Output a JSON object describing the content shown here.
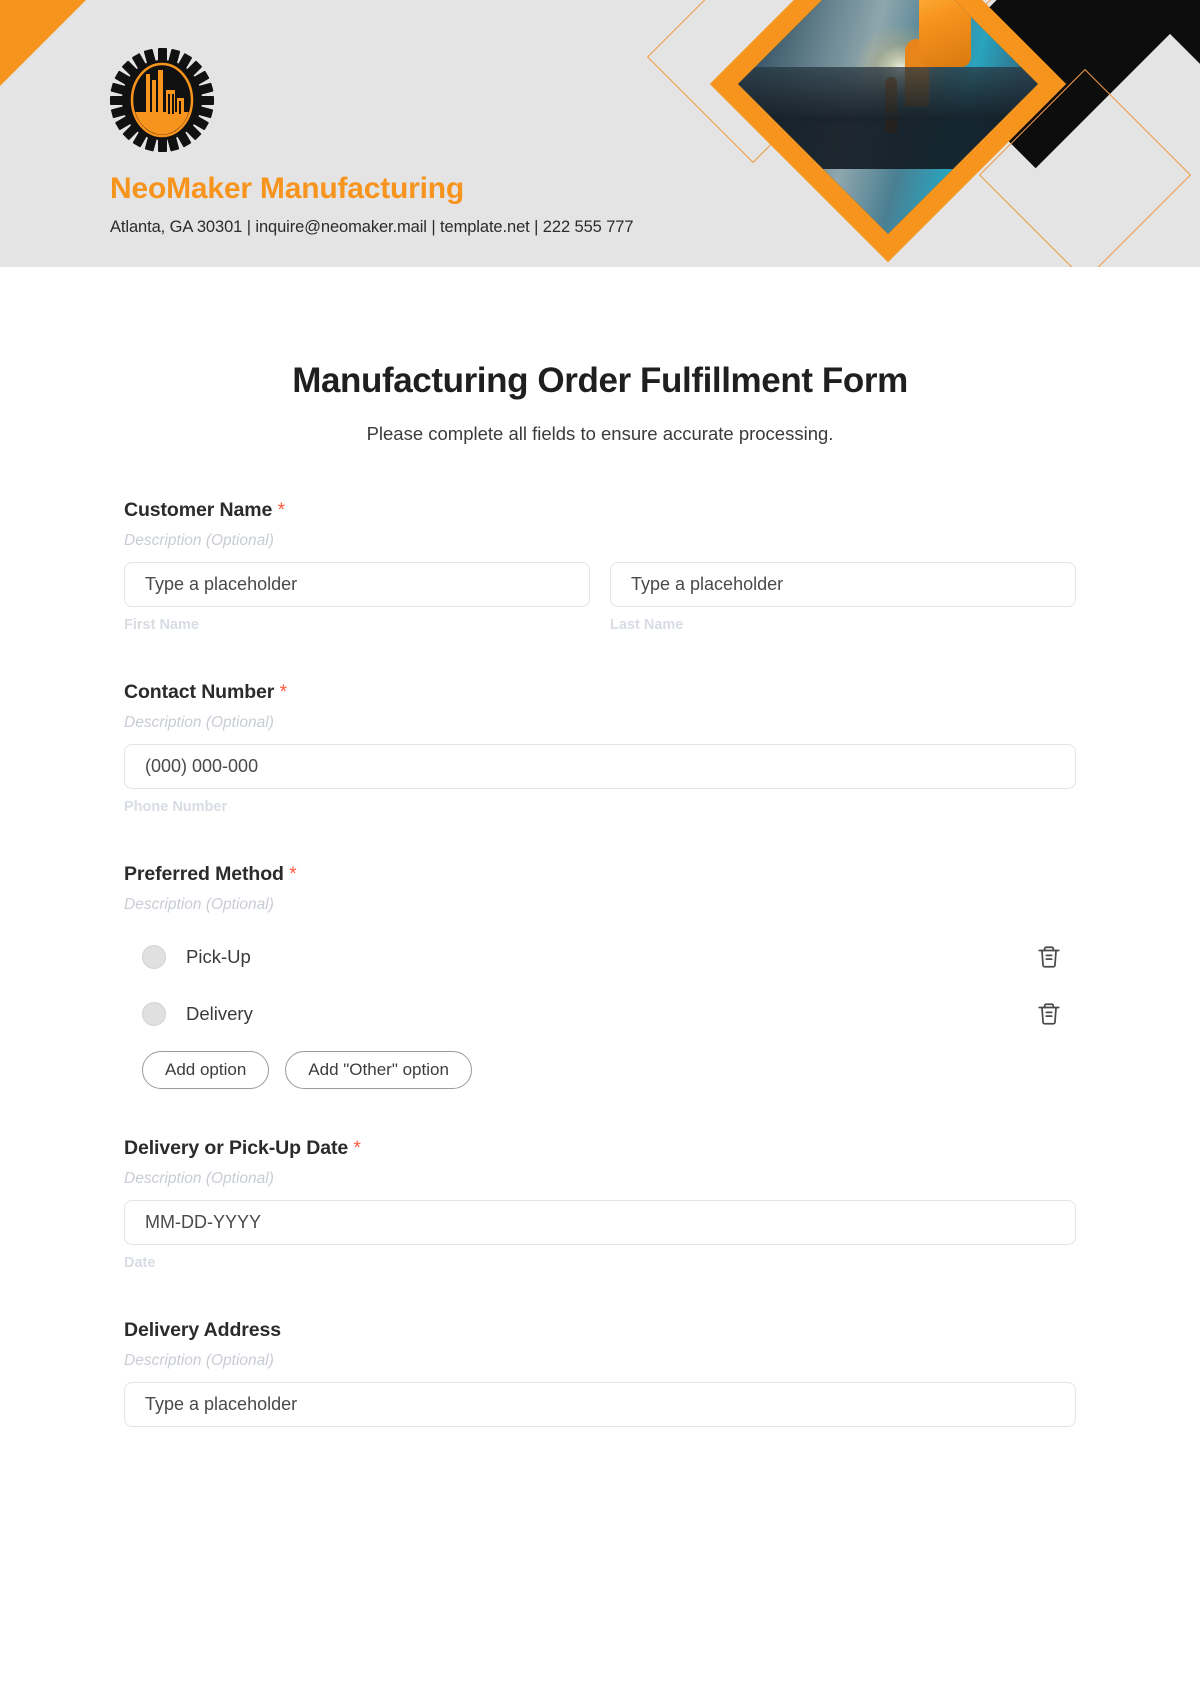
{
  "brand": {
    "name": "NeoMaker Manufacturing",
    "contact": "Atlanta, GA 30301 | inquire@neomaker.mail | template.net | 222 555 777",
    "accent_color": "#f7941e",
    "header_bg": "#e4e4e4",
    "logo_icon": "gear-factory-icon",
    "header_image_icon": "industrial-robot-welding-photo"
  },
  "form": {
    "title": "Manufacturing Order Fulfillment Form",
    "subtitle": "Please complete all fields to ensure accurate processing.",
    "required_marker": "*",
    "description_placeholder": "Description (Optional)",
    "fields": [
      {
        "label": "Customer Name",
        "required": true,
        "description": "Description (Optional)",
        "inputs": [
          {
            "placeholder": "Type a placeholder",
            "sub_label": "First Name"
          },
          {
            "placeholder": "Type a placeholder",
            "sub_label": "Last Name"
          }
        ]
      },
      {
        "label": "Contact Number",
        "required": true,
        "description": "Description (Optional)",
        "inputs": [
          {
            "placeholder": "(000) 000-000",
            "sub_label": "Phone Number"
          }
        ]
      },
      {
        "label": "Preferred Method",
        "required": true,
        "description": "Description (Optional)",
        "options": [
          {
            "label": "Pick-Up",
            "delete_icon": "trash-icon"
          },
          {
            "label": "Delivery",
            "delete_icon": "trash-icon"
          }
        ],
        "buttons": [
          {
            "label": "Add option"
          },
          {
            "label": "Add \"Other\" option"
          }
        ]
      },
      {
        "label": "Delivery or Pick-Up Date",
        "required": true,
        "description": "Description (Optional)",
        "inputs": [
          {
            "placeholder": "MM-DD-YYYY",
            "sub_label": "Date"
          }
        ]
      },
      {
        "label": "Delivery Address",
        "required": false,
        "description": "Description (Optional)",
        "inputs": [
          {
            "placeholder": "Type a placeholder",
            "sub_label": ""
          }
        ]
      }
    ]
  }
}
